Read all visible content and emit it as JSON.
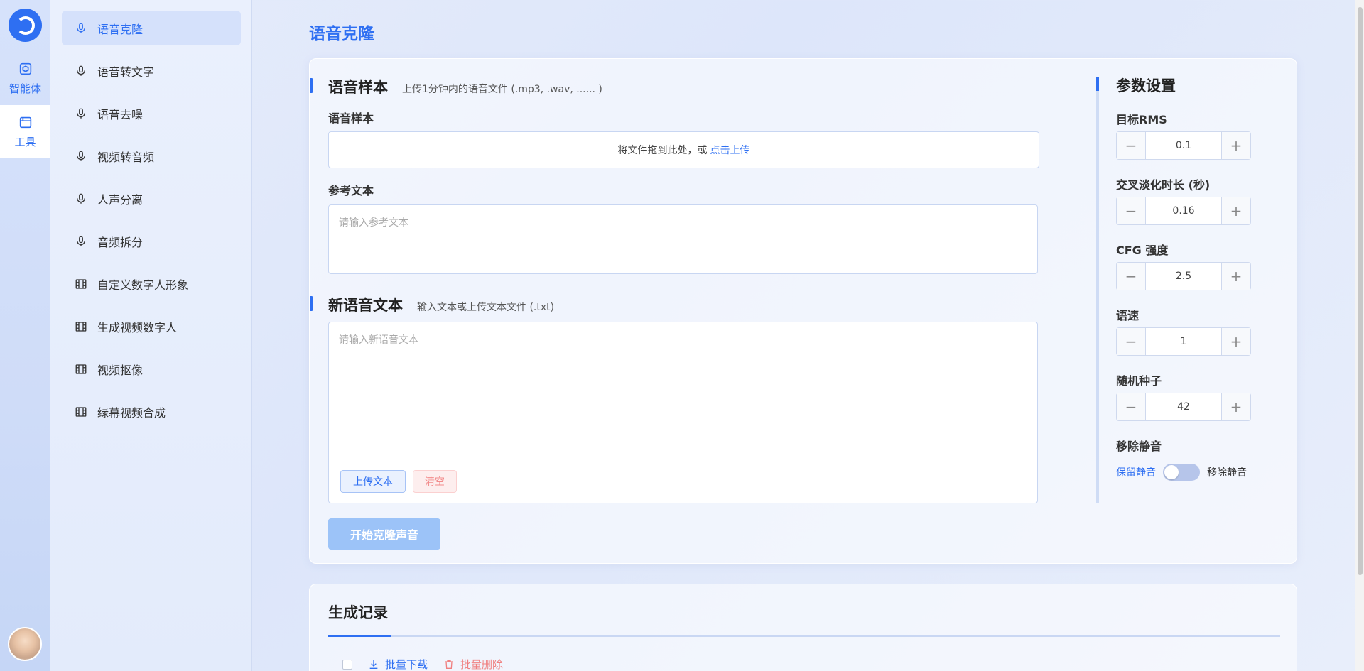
{
  "rail": {
    "items": [
      {
        "label": "智能体",
        "icon": "agent-icon"
      },
      {
        "label": "工具",
        "icon": "tools-icon"
      }
    ]
  },
  "sidebar": {
    "items": [
      {
        "label": "语音克隆",
        "icon": "microphone-icon"
      },
      {
        "label": "语音转文字",
        "icon": "microphone-icon"
      },
      {
        "label": "语音去噪",
        "icon": "microphone-icon"
      },
      {
        "label": "视频转音频",
        "icon": "microphone-icon"
      },
      {
        "label": "人声分离",
        "icon": "microphone-icon"
      },
      {
        "label": "音频拆分",
        "icon": "microphone-icon"
      },
      {
        "label": "自定义数字人形象",
        "icon": "film-icon"
      },
      {
        "label": "生成视频数字人",
        "icon": "film-icon"
      },
      {
        "label": "视频抠像",
        "icon": "film-icon"
      },
      {
        "label": "绿幕视频合成",
        "icon": "film-icon"
      }
    ]
  },
  "page": {
    "title": "语音克隆"
  },
  "sample": {
    "title": "语音样本",
    "subtitle": "上传1分钟内的语音文件 (.mp3, .wav, ...... )",
    "field_label": "语音样本",
    "drop_text": "将文件拖到此处，或",
    "drop_link": "点击上传"
  },
  "reference": {
    "label": "参考文本",
    "placeholder": "请输入参考文本"
  },
  "new_text": {
    "title": "新语音文本",
    "subtitle": "输入文本或上传文本文件 (.txt)",
    "placeholder": "请输入新语音文本",
    "upload_label": "上传文本",
    "clear_label": "清空"
  },
  "start_label": "开始克隆声音",
  "params": {
    "title": "参数设置",
    "items": [
      {
        "label": "目标RMS",
        "value": "0.1"
      },
      {
        "label": "交叉淡化时长 (秒)",
        "value": "0.16"
      },
      {
        "label": "CFG 强度",
        "value": "2.5"
      },
      {
        "label": "语速",
        "value": "1"
      },
      {
        "label": "随机种子",
        "value": "42"
      }
    ],
    "silence": {
      "label": "移除静音",
      "option_keep": "保留静音",
      "option_remove": "移除静音",
      "state": "off"
    }
  },
  "records": {
    "title": "生成记录",
    "download_label": "批量下载",
    "delete_label": "批量删除"
  }
}
